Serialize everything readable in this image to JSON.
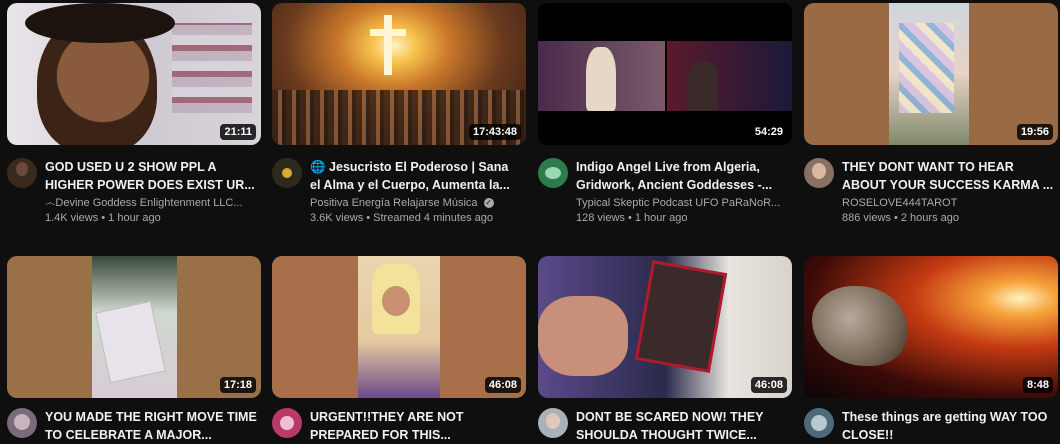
{
  "videos": [
    {
      "title": "GOD USED U 2 SHOW PPL A HIGHER POWER DOES EXIST UR...",
      "channel": "෴Devine Goddess Enlightenment LLC...",
      "meta": "1.4K views • 1 hour ago",
      "duration": "21:11",
      "avatar_color": "#3a2a1e"
    },
    {
      "title": "🌐 Jesucristo El Poderoso | Sana el Alma y el Cuerpo, Aumenta la...",
      "channel": "Positiva Energía Relajarse Música",
      "verified": "✓",
      "meta": "3.6K views • Streamed 4 minutes ago",
      "duration": "17:43:48",
      "avatar_color": "#2b2a1c"
    },
    {
      "title": "Indigo Angel Live from Algeria, Gridwork, Ancient Goddesses -...",
      "channel": "Typical Skeptic Podcast UFO PaRaNoR...",
      "meta": "128 views • 1 hour ago",
      "duration": "54:29",
      "avatar_color": "#2f7a4a"
    },
    {
      "title": "THEY DONT WANT TO HEAR ABOUT YOUR SUCCESS KARMA ...",
      "channel": "ROSELOVE444TAROT",
      "meta": "886 views • 2 hours ago",
      "duration": "19:56",
      "avatar_color": "#8a7062"
    },
    {
      "title": "YOU MADE THE RIGHT MOVE TIME TO CELEBRATE A MAJOR...",
      "duration": "17:18",
      "avatar_color": "#7b6b78"
    },
    {
      "title": "URGENT!!THEY ARE NOT PREPARED FOR THIS...",
      "duration": "46:08",
      "avatar_color": "#b83a6a"
    },
    {
      "title": "DONT BE SCARED NOW! THEY SHOULDA THOUGHT TWICE...",
      "duration": "46:08",
      "avatar_color": "#a9b2b8"
    },
    {
      "title": "These things are getting WAY TOO CLOSE!!",
      "duration": "8:48",
      "avatar_color": "#4d6a7a"
    }
  ]
}
